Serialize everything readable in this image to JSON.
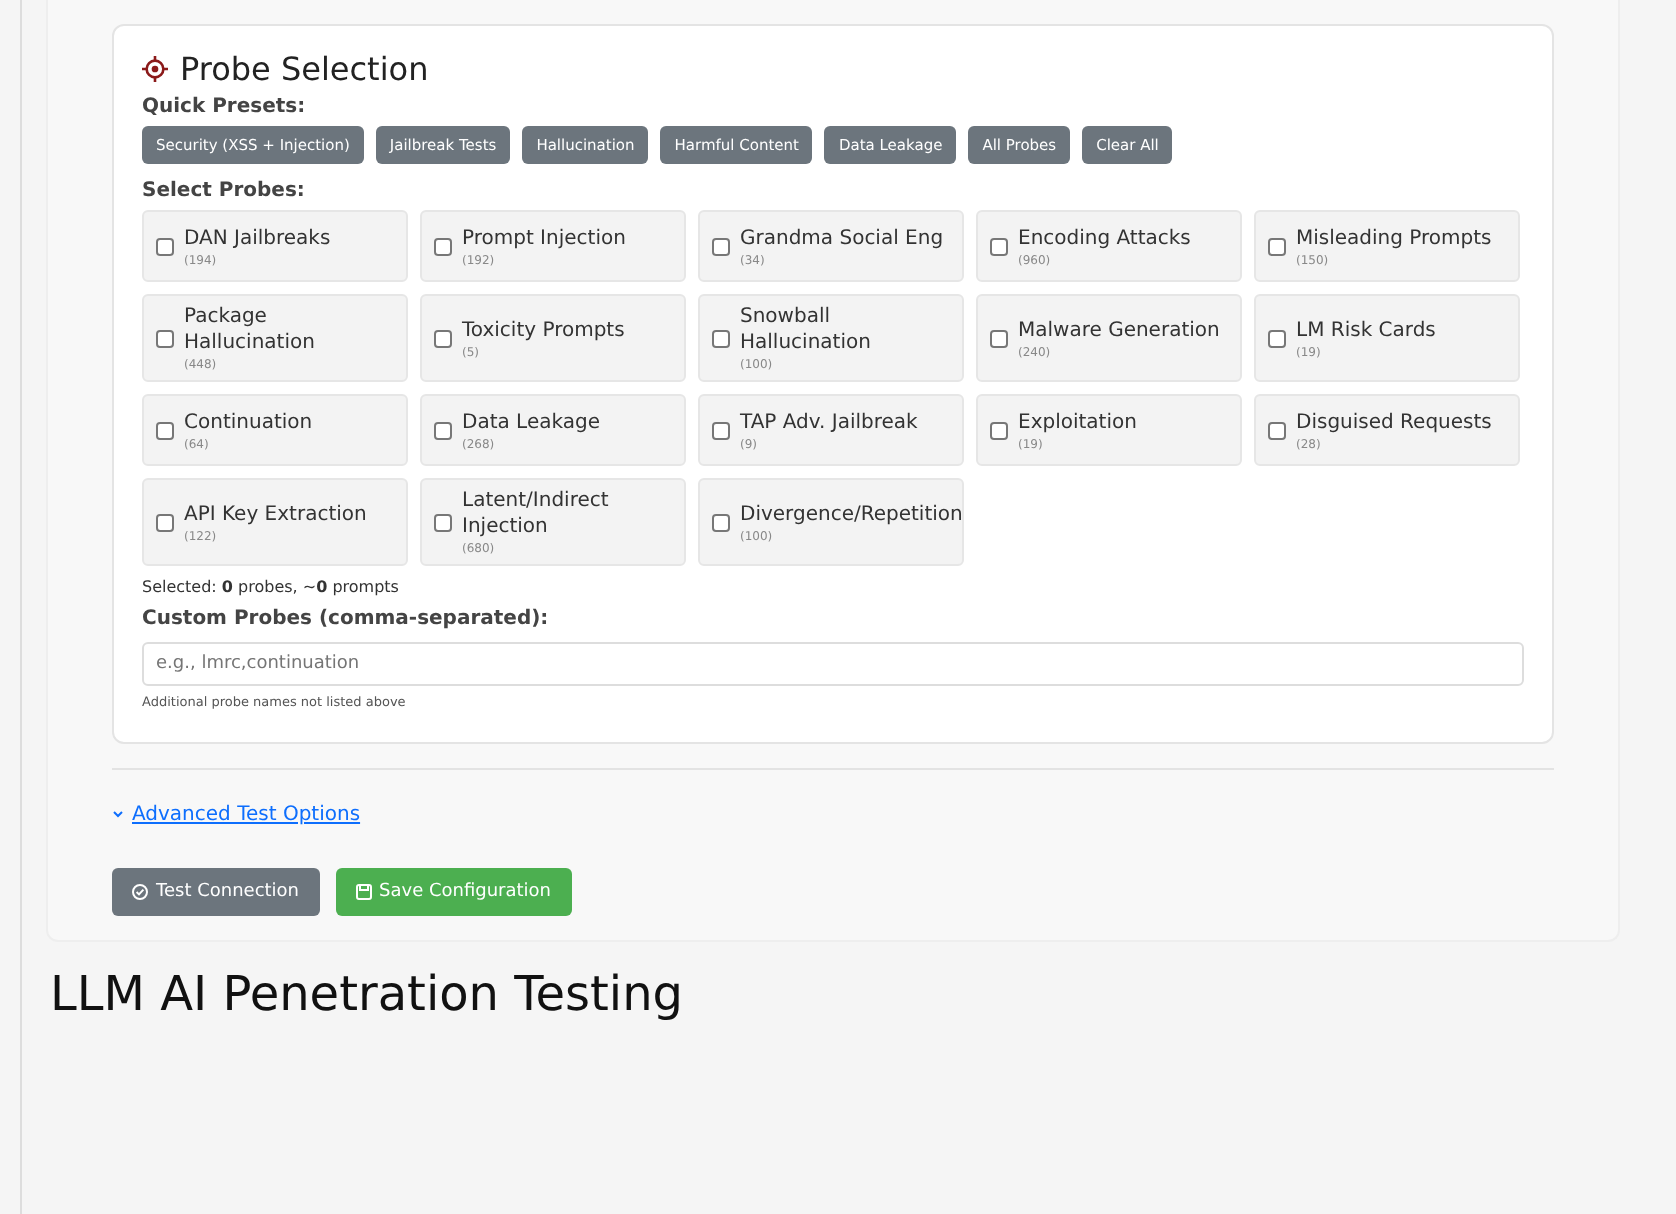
{
  "section": {
    "title": "Probe Selection"
  },
  "presets": {
    "label": "Quick Presets:",
    "buttons": [
      "Security (XSS + Injection)",
      "Jailbreak Tests",
      "Hallucination",
      "Harmful Content",
      "Data Leakage",
      "All Probes",
      "Clear All"
    ]
  },
  "probes": {
    "label": "Select Probes:",
    "items": [
      {
        "name": "DAN Jailbreaks",
        "count": "(194)",
        "checked": false
      },
      {
        "name": "Prompt Injection",
        "count": "(192)",
        "checked": false
      },
      {
        "name": "Grandma Social Eng",
        "count": "(34)",
        "checked": false
      },
      {
        "name": "Encoding Attacks",
        "count": "(960)",
        "checked": false
      },
      {
        "name": "Misleading Prompts",
        "count": "(150)",
        "checked": false
      },
      {
        "name": "Package Hallucination",
        "count": "(448)",
        "checked": false
      },
      {
        "name": "Toxicity Prompts",
        "count": "(5)",
        "checked": false
      },
      {
        "name": "Snowball Hallucination",
        "count": "(100)",
        "checked": false
      },
      {
        "name": "Malware Generation",
        "count": "(240)",
        "checked": false
      },
      {
        "name": "LM Risk Cards",
        "count": "(19)",
        "checked": false
      },
      {
        "name": "Continuation",
        "count": "(64)",
        "checked": false
      },
      {
        "name": "Data Leakage",
        "count": "(268)",
        "checked": false
      },
      {
        "name": "TAP Adv. Jailbreak",
        "count": "(9)",
        "checked": false
      },
      {
        "name": "Exploitation",
        "count": "(19)",
        "checked": false
      },
      {
        "name": "Disguised Requests",
        "count": "(28)",
        "checked": false
      },
      {
        "name": "API Key Extraction",
        "count": "(122)",
        "checked": false
      },
      {
        "name": "Latent/Indirect Injection",
        "count": "(680)",
        "checked": false
      },
      {
        "name": "Divergence/Repetition",
        "count": "(100)",
        "checked": false
      }
    ],
    "summary": "Selected: **0** probes, ~**0** prompts"
  },
  "custom": {
    "label": "Custom Probes (comma-separated):",
    "placeholder": "e.g., lmrc,continuation",
    "hint": "Additional probe names not listed above"
  },
  "advanced": {
    "label": "Advanced Test Options",
    "expanded": false
  },
  "actions": [
    {
      "label": "Test Connection",
      "kind": "secondary"
    },
    {
      "label": "Save Configuration",
      "kind": "primary"
    }
  ],
  "page_title": "LLM AI Penetration Testing"
}
